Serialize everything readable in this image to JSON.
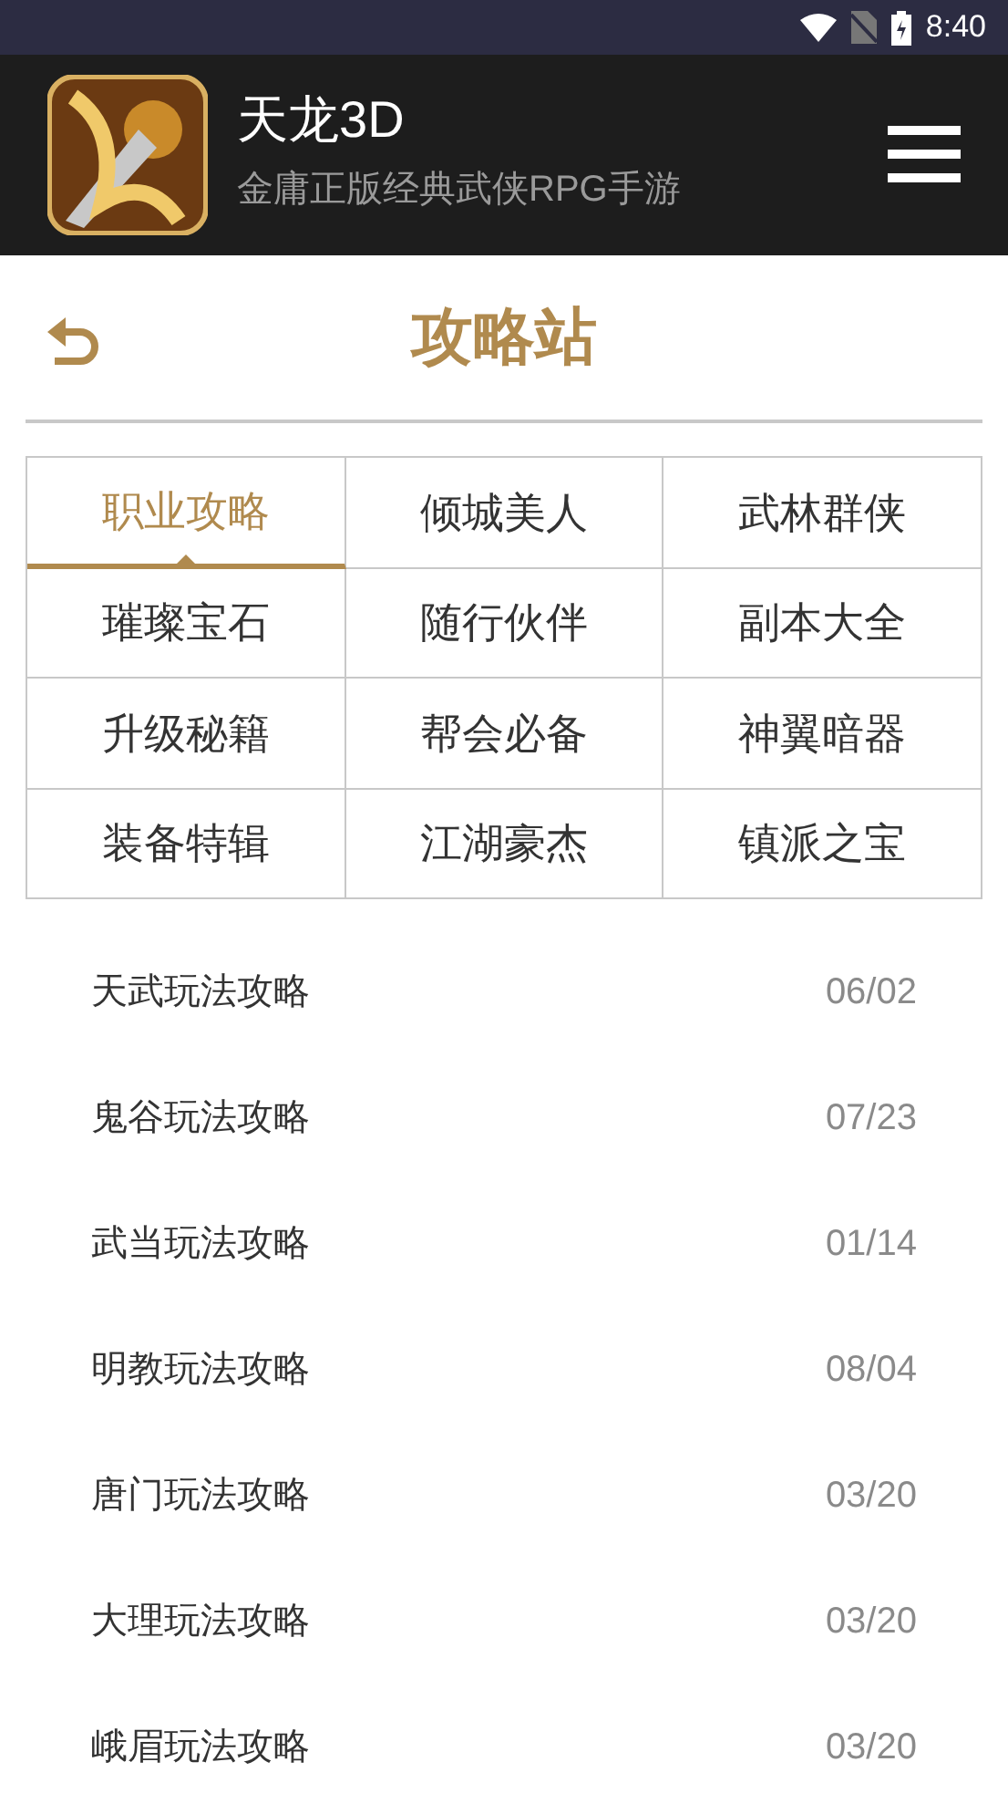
{
  "status_bar": {
    "time": "8:40"
  },
  "header": {
    "title": "天龙3D",
    "subtitle": "金庸正版经典武侠RPG手游"
  },
  "page": {
    "title": "攻略站"
  },
  "categories": [
    {
      "label": "职业攻略",
      "selected": true
    },
    {
      "label": "倾城美人",
      "selected": false
    },
    {
      "label": "武林群侠",
      "selected": false
    },
    {
      "label": "璀璨宝石",
      "selected": false
    },
    {
      "label": "随行伙伴",
      "selected": false
    },
    {
      "label": "副本大全",
      "selected": false
    },
    {
      "label": "升级秘籍",
      "selected": false
    },
    {
      "label": "帮会必备",
      "selected": false
    },
    {
      "label": "神翼暗器",
      "selected": false
    },
    {
      "label": "装备特辑",
      "selected": false
    },
    {
      "label": "江湖豪杰",
      "selected": false
    },
    {
      "label": "镇派之宝",
      "selected": false
    }
  ],
  "articles": [
    {
      "title": "天武玩法攻略",
      "date": "06/02"
    },
    {
      "title": "鬼谷玩法攻略",
      "date": "07/23"
    },
    {
      "title": "武当玩法攻略",
      "date": "01/14"
    },
    {
      "title": "明教玩法攻略",
      "date": "08/04"
    },
    {
      "title": "唐门玩法攻略",
      "date": "03/20"
    },
    {
      "title": "大理玩法攻略",
      "date": "03/20"
    },
    {
      "title": "峨眉玩法攻略",
      "date": "03/20"
    }
  ]
}
